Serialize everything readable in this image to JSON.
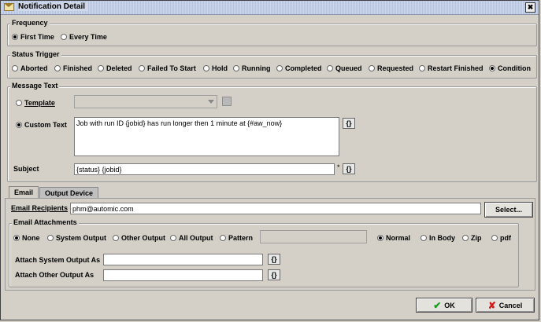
{
  "window": {
    "title": "Notification Detail",
    "close_symbol": "✖"
  },
  "frequency": {
    "title": "Frequency",
    "options": [
      {
        "label": "First Time",
        "checked": true
      },
      {
        "label": "Every Time",
        "checked": false
      }
    ]
  },
  "status_trigger": {
    "title": "Status Trigger",
    "options": [
      {
        "label": "Aborted",
        "checked": false
      },
      {
        "label": "Finished",
        "checked": false
      },
      {
        "label": "Deleted",
        "checked": false
      },
      {
        "label": "Failed To Start",
        "checked": false
      },
      {
        "label": "Hold",
        "checked": false
      },
      {
        "label": "Running",
        "checked": false
      },
      {
        "label": "Completed",
        "checked": false
      },
      {
        "label": "Queued",
        "checked": false
      },
      {
        "label": "Requested",
        "checked": false
      },
      {
        "label": "Restart Finished",
        "checked": false
      },
      {
        "label": "Condition",
        "checked": true
      }
    ]
  },
  "message_text": {
    "title": "Message Text",
    "template_label": "Template",
    "custom_text_label": "Custom Text",
    "custom_text_value": "Job with run ID {jobid} has run longer then 1 minute at {#aw_now}",
    "subject_label": "Subject",
    "subject_value": "{status} {jobid}",
    "required_mark": "*",
    "var_button": "{}"
  },
  "tabs": [
    {
      "label": "Email",
      "active": true
    },
    {
      "label": "Output Device",
      "active": false
    }
  ],
  "email": {
    "recipients_label": "Email Recipients",
    "recipients_value": "phm@automic.com",
    "select_button": "Select...",
    "attachments_title": "Email Attachments",
    "attach_options": [
      {
        "label": "None",
        "checked": true
      },
      {
        "label": "System Output",
        "checked": false
      },
      {
        "label": "Other Output",
        "checked": false
      },
      {
        "label": "All Output",
        "checked": false
      },
      {
        "label": "Pattern",
        "checked": false
      }
    ],
    "format_options": [
      {
        "label": "Normal",
        "checked": true
      },
      {
        "label": "In Body",
        "checked": false
      },
      {
        "label": "Zip",
        "checked": false
      },
      {
        "label": "pdf",
        "checked": false
      }
    ],
    "attach_system_label": "Attach System Output As",
    "attach_other_label": "Attach Other Output As",
    "var_button": "{}"
  },
  "buttons": {
    "ok": "OK",
    "cancel": "Cancel"
  }
}
